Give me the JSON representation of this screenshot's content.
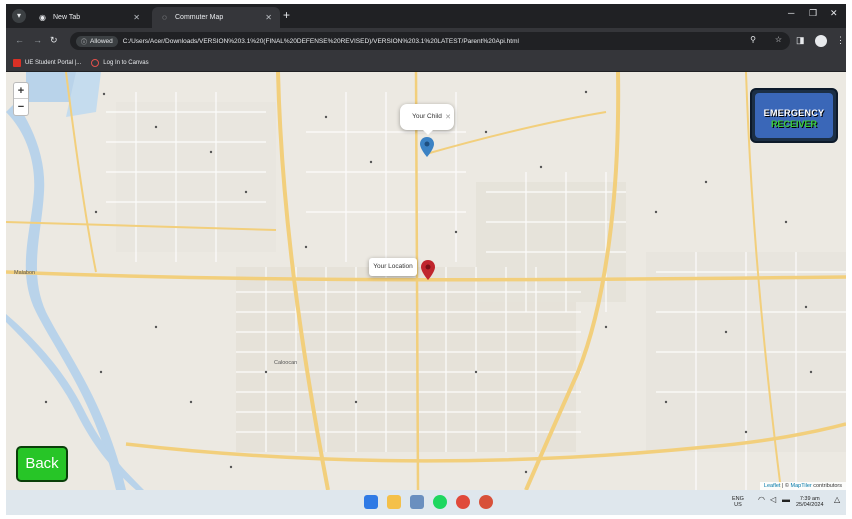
{
  "browser": {
    "tabs": [
      {
        "label": "New Tab",
        "active": false
      },
      {
        "label": "Commuter Map",
        "active": true
      }
    ],
    "address": {
      "chip": "Allowed",
      "url": "C:/Users/Acer/Downloads/VERSION%203.1%20(FINAL%20DEFENSE%20REVISED)/VERSION%203.1%20LATEST/Parent%20Api.html"
    },
    "bookmarks": [
      {
        "label": "UE Student Portal |..."
      },
      {
        "label": "Log In to Canvas"
      }
    ]
  },
  "map": {
    "popup_child": "Your Child",
    "popup_location": "Your Location",
    "place_labels": {
      "malabon": "Malabon",
      "caloocan": "Caloocan"
    },
    "logo": {
      "line1": "EMERGENCY",
      "line2": "RECEIVER"
    },
    "back_label": "Back",
    "attribution": {
      "leaflet": "Leaflet",
      "sep": "| ©",
      "maptiler": "MapTiler",
      "rest": "contributors"
    },
    "colors": {
      "child_marker": "#3b82c4",
      "you_marker": "#c0252d",
      "back_button": "#27c527"
    }
  },
  "taskbar": {
    "lang": "ENG",
    "region": "US",
    "time": "7:39 am",
    "date": "25/04/2024"
  }
}
